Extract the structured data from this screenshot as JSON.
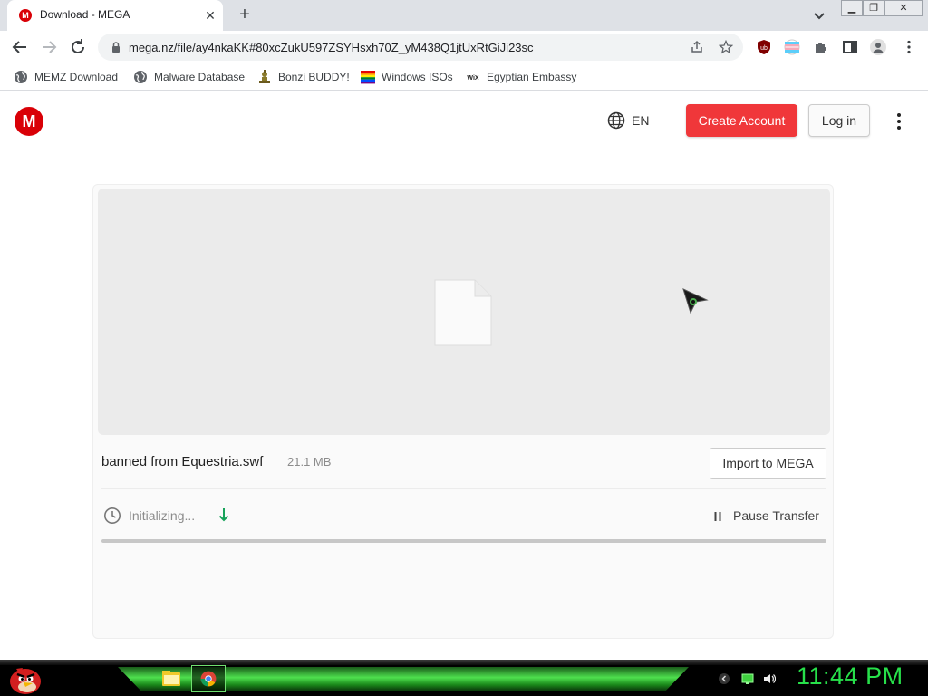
{
  "browser": {
    "tab": {
      "title": "Download - MEGA",
      "favicon": "M"
    },
    "url": "mega.nz/file/ay4nkaKK#80xcZukU597ZSYHsxh70Z_yM438Q1jtUxRtGiJi23sc",
    "bookmarks": [
      {
        "label": "MEMZ Download",
        "icon": "globe-icon"
      },
      {
        "label": "Malware Database",
        "icon": "globe-icon"
      },
      {
        "label": "Bonzi BUDDY!",
        "icon": "bonzi-icon"
      },
      {
        "label": "Windows ISOs",
        "icon": "windows-flag-icon"
      },
      {
        "label": "Egyptian Embassy",
        "icon": "wix-icon"
      }
    ],
    "extensions": [
      "ublock-origin-icon",
      "trans-flag-extension-icon",
      "puzzle-extensions-icon",
      "side-panel-icon",
      "profile-icon",
      "chrome-menu-icon"
    ]
  },
  "mega": {
    "logo": "M",
    "language": "EN",
    "create_account_label": "Create Account",
    "login_label": "Log in"
  },
  "download": {
    "filename": "banned from Equestria.swf",
    "size": "21.1 MB",
    "import_label": "Import to MEGA",
    "status": "Initializing...",
    "pause_label": "Pause Transfer",
    "progress": 0
  },
  "taskbar": {
    "time": "11:44 PM",
    "apps": [
      "file-explorer-icon",
      "chrome-icon"
    ],
    "tray": [
      "tray-arrow-icon",
      "network-icon",
      "volume-icon"
    ]
  },
  "colors": {
    "mega_red": "#d90007",
    "create_button": "#f0373a",
    "clock_green": "#27e04a",
    "taskbar_green": "#4ee04e"
  }
}
